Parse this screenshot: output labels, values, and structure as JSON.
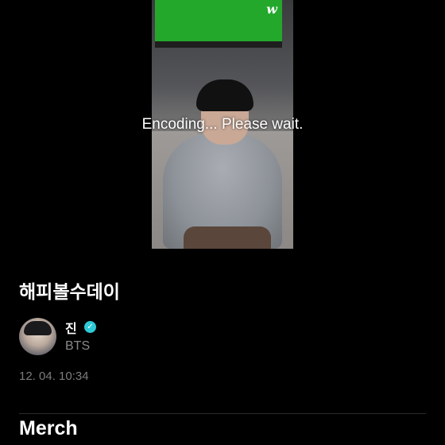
{
  "video": {
    "status_text": "Encoding... Please wait.",
    "screen_logo": "w"
  },
  "post": {
    "title": "해피볼수데이",
    "author": {
      "name": "진",
      "group": "BTS",
      "verified": true,
      "avatar_icon": "user-avatar"
    },
    "timestamp": "12. 04. 10:34"
  },
  "sections": {
    "merch_title": "Merch"
  },
  "colors": {
    "background": "#000000",
    "verified_badge": "#2ec9d6",
    "secondary_text": "#8a8a8a"
  }
}
